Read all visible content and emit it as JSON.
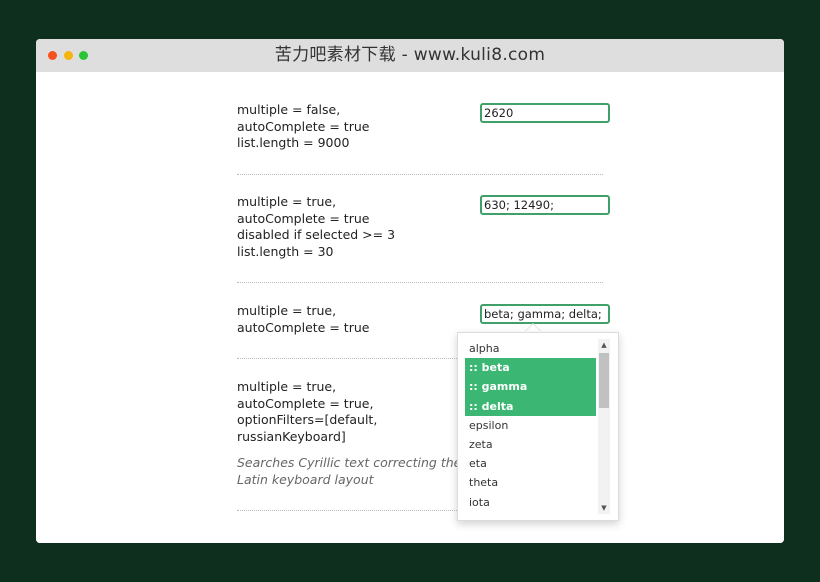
{
  "window": {
    "title": "苦力吧素材下载 - www.kuli8.com"
  },
  "examples": [
    {
      "lines": [
        "multiple = false,",
        "autoComplete = true",
        "list.length = 9000"
      ],
      "value": "2620"
    },
    {
      "lines": [
        "multiple = true,",
        "autoComplete = true",
        "disabled if selected >= 3",
        "list.length = 30"
      ],
      "value": "630; 12490;"
    },
    {
      "lines": [
        "multiple = true,",
        "autoComplete = true"
      ],
      "value": "beta; gamma; delta;"
    },
    {
      "lines": [
        "multiple = true,",
        "autoComplete = true,",
        "optionFilters=[default,",
        "russianKeyboard]"
      ],
      "note": [
        "Searches Cyrillic text correcting the",
        "Latin keyboard layout"
      ]
    }
  ],
  "dropdown": {
    "options": [
      {
        "label": "alpha",
        "selected": false
      },
      {
        "label": ":: beta",
        "selected": true
      },
      {
        "label": ":: gamma",
        "selected": true
      },
      {
        "label": ":: delta",
        "selected": true
      },
      {
        "label": "epsilon",
        "selected": false
      },
      {
        "label": "zeta",
        "selected": false
      },
      {
        "label": "eta",
        "selected": false
      },
      {
        "label": "theta",
        "selected": false
      },
      {
        "label": "iota",
        "selected": false
      }
    ],
    "scroll_up_icon": "chevron-up-icon",
    "scroll_down_icon": "chevron-down-icon"
  },
  "colors": {
    "accent": "#3cb673",
    "field_border": "#3fa06a",
    "page_background": "#0e2f1d"
  }
}
